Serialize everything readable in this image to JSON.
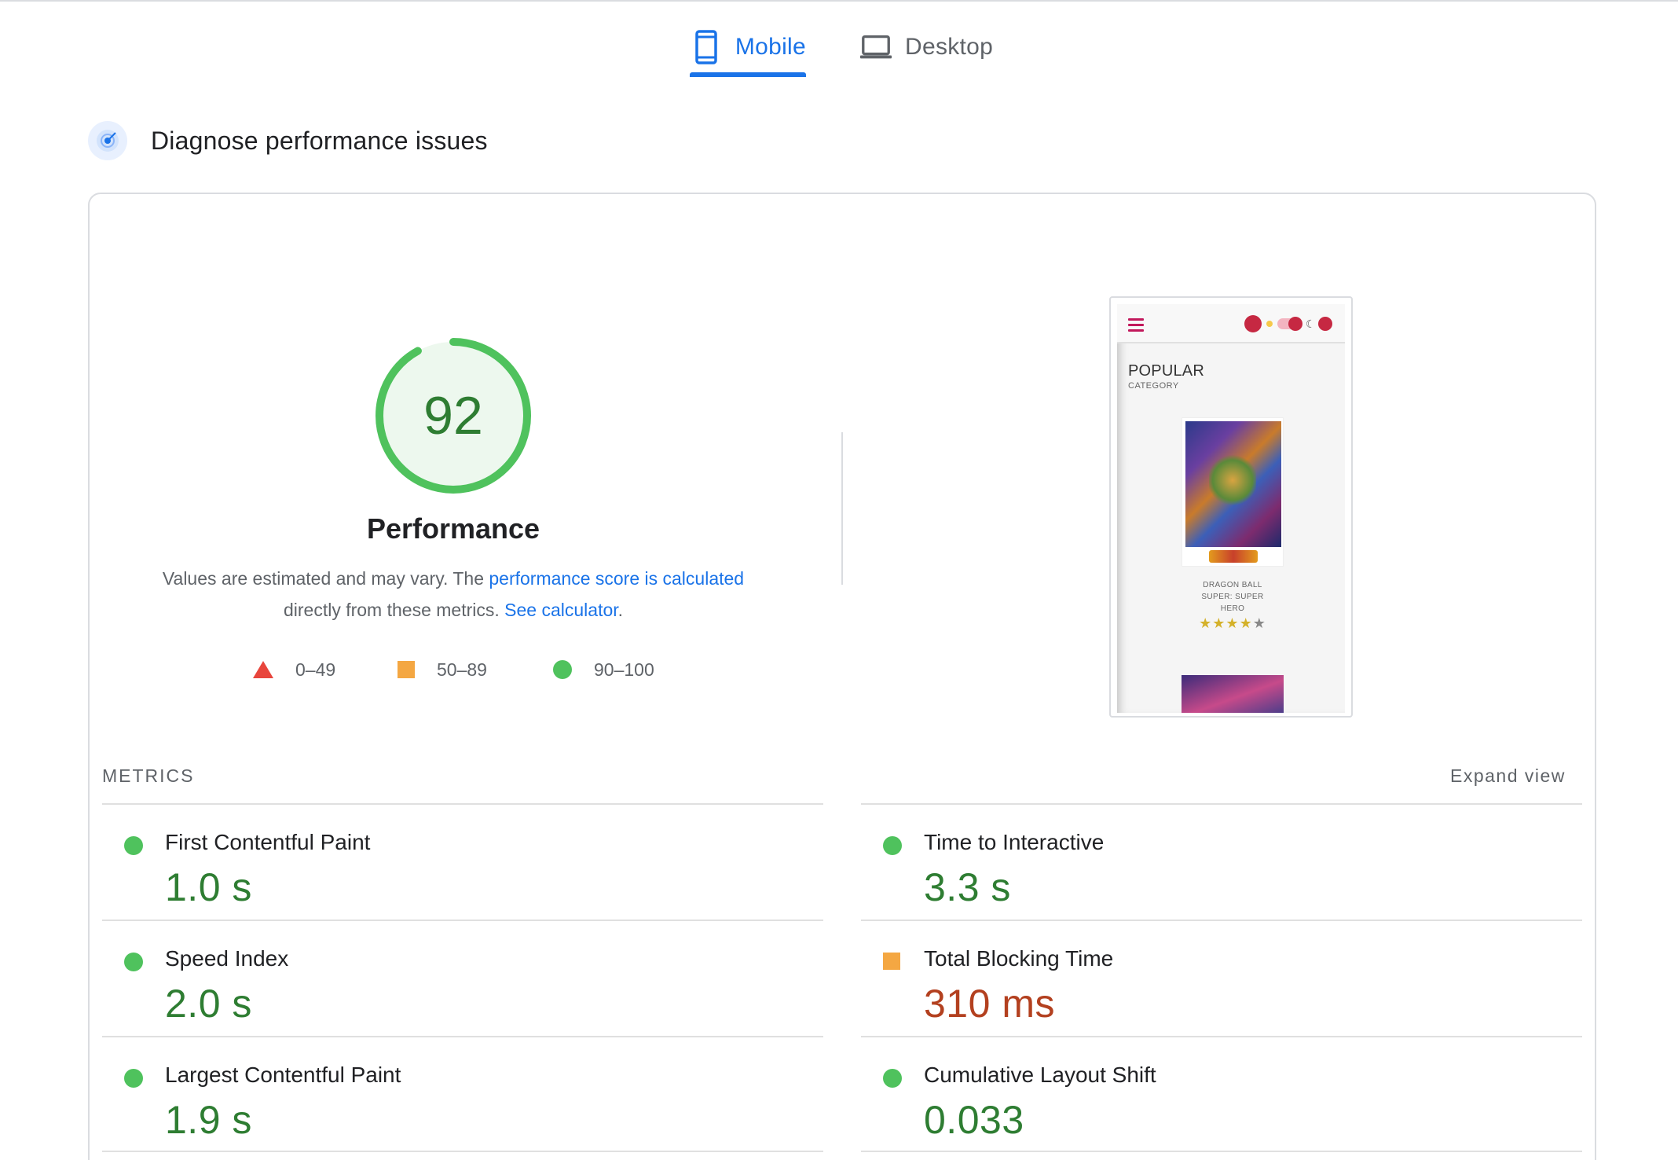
{
  "tabs": [
    {
      "label": "Mobile",
      "icon": "smartphone-icon",
      "active": true
    },
    {
      "label": "Desktop",
      "icon": "laptop-icon",
      "active": false
    }
  ],
  "section": {
    "title": "Diagnose performance issues",
    "icon": "diagnose-icon"
  },
  "score": {
    "value": "92",
    "fraction": 0.92,
    "title": "Performance",
    "desc_prefix": "Values are estimated and may vary. The ",
    "link_calculated": "performance score is calculated",
    "desc_middle": " directly from these metrics. ",
    "link_calculator": "See calculator",
    "desc_suffix": ".",
    "color": "#0cce6b"
  },
  "legend": [
    {
      "shape": "triangle",
      "range": "0–49",
      "color": "#e8453c"
    },
    {
      "shape": "square",
      "range": "50–89",
      "color": "#f4a742"
    },
    {
      "shape": "circle",
      "range": "90–100",
      "color": "#4fc25d"
    }
  ],
  "thumbnail": {
    "heading": "POPULAR",
    "subheading": "CATEGORY",
    "movie_title_line1": "DRAGON BALL",
    "movie_title_line2": "SUPER: SUPER",
    "movie_title_line3": "HERO",
    "rating_stars": 4,
    "rating_max": 5
  },
  "metrics": {
    "label": "METRICS",
    "expand": "Expand view",
    "items": [
      {
        "name": "First Contentful Paint",
        "value": "1.0 s",
        "status": "pass"
      },
      {
        "name": "Time to Interactive",
        "value": "3.3 s",
        "status": "pass"
      },
      {
        "name": "Speed Index",
        "value": "2.0 s",
        "status": "pass"
      },
      {
        "name": "Total Blocking Time",
        "value": "310 ms",
        "status": "average"
      },
      {
        "name": "Largest Contentful Paint",
        "value": "1.9 s",
        "status": "pass"
      },
      {
        "name": "Cumulative Layout Shift",
        "value": "0.033",
        "status": "pass"
      }
    ]
  }
}
